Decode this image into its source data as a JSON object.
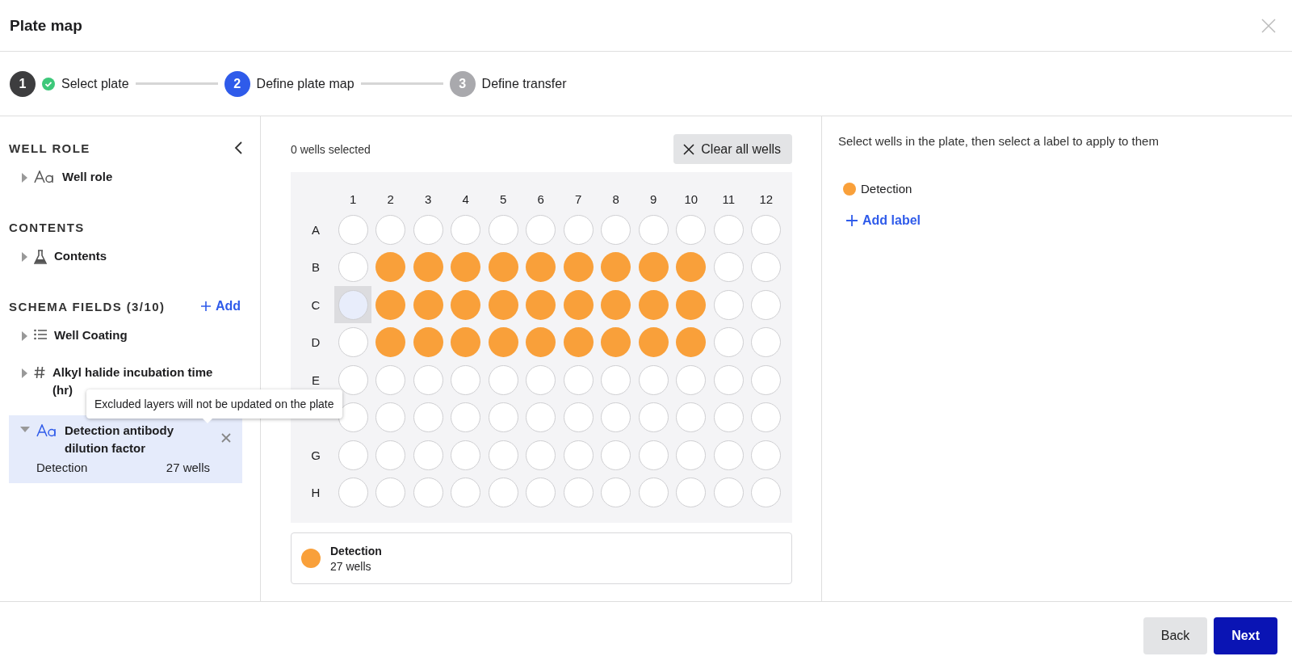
{
  "dialog": {
    "title": "Plate map"
  },
  "steps": [
    {
      "number": "1",
      "label": "Select plate",
      "kind": "done"
    },
    {
      "number": "2",
      "label": "Define plate map",
      "kind": "current"
    },
    {
      "number": "3",
      "label": "Define transfer",
      "kind": "upcoming"
    }
  ],
  "sidebar": {
    "sections": [
      {
        "heading": "WELL ROLE",
        "collapse": true,
        "items": [
          {
            "kind": "text",
            "label": "Well role",
            "expanded": false,
            "selected": false
          }
        ]
      },
      {
        "heading": "CONTENTS",
        "items": [
          {
            "kind": "flask",
            "label": "Contents",
            "expanded": false,
            "selected": false
          }
        ]
      },
      {
        "heading": "SCHEMA FIELDS (3/10)",
        "action": "Add",
        "items": [
          {
            "kind": "list",
            "label": "Well Coating",
            "expanded": false,
            "selected": false
          },
          {
            "kind": "number",
            "label": "Alkyl halide incubation time (hr)",
            "expanded": false,
            "selected": false
          },
          {
            "kind": "text",
            "label": "Detection antibody dilution factor",
            "expanded": true,
            "selected": true,
            "values": [
              {
                "label": "Detection",
                "count": "27 wells"
              }
            ]
          }
        ]
      }
    ]
  },
  "tooltip": "Excluded layers will not be updated on the plate",
  "plate": {
    "selection_count": "0 wells selected",
    "clear_button": "Clear all wells",
    "columns": [
      "1",
      "2",
      "3",
      "4",
      "5",
      "6",
      "7",
      "8",
      "9",
      "10",
      "11",
      "12"
    ],
    "rows": [
      {
        "label": "A",
        "wells": [
          {
            "kind": "empty"
          },
          {
            "kind": "empty"
          },
          {
            "kind": "empty"
          },
          {
            "kind": "empty"
          },
          {
            "kind": "empty"
          },
          {
            "kind": "empty"
          },
          {
            "kind": "empty"
          },
          {
            "kind": "empty"
          },
          {
            "kind": "empty"
          },
          {
            "kind": "empty"
          },
          {
            "kind": "empty"
          },
          {
            "kind": "empty"
          }
        ]
      },
      {
        "label": "B",
        "wells": [
          {
            "kind": "empty"
          },
          {
            "kind": "filled"
          },
          {
            "kind": "filled"
          },
          {
            "kind": "filled"
          },
          {
            "kind": "filled"
          },
          {
            "kind": "filled"
          },
          {
            "kind": "filled"
          },
          {
            "kind": "filled"
          },
          {
            "kind": "filled"
          },
          {
            "kind": "filled"
          },
          {
            "kind": "empty"
          },
          {
            "kind": "empty"
          }
        ]
      },
      {
        "label": "C",
        "wells": [
          {
            "kind": "hover"
          },
          {
            "kind": "filled"
          },
          {
            "kind": "filled"
          },
          {
            "kind": "filled"
          },
          {
            "kind": "filled"
          },
          {
            "kind": "filled"
          },
          {
            "kind": "filled"
          },
          {
            "kind": "filled"
          },
          {
            "kind": "filled"
          },
          {
            "kind": "filled"
          },
          {
            "kind": "empty"
          },
          {
            "kind": "empty"
          }
        ]
      },
      {
        "label": "D",
        "wells": [
          {
            "kind": "empty"
          },
          {
            "kind": "filled"
          },
          {
            "kind": "filled"
          },
          {
            "kind": "filled"
          },
          {
            "kind": "filled"
          },
          {
            "kind": "filled"
          },
          {
            "kind": "filled"
          },
          {
            "kind": "filled"
          },
          {
            "kind": "filled"
          },
          {
            "kind": "filled"
          },
          {
            "kind": "empty"
          },
          {
            "kind": "empty"
          }
        ]
      },
      {
        "label": "E",
        "wells": [
          {
            "kind": "empty"
          },
          {
            "kind": "empty"
          },
          {
            "kind": "empty"
          },
          {
            "kind": "empty"
          },
          {
            "kind": "empty"
          },
          {
            "kind": "empty"
          },
          {
            "kind": "empty"
          },
          {
            "kind": "empty"
          },
          {
            "kind": "empty"
          },
          {
            "kind": "empty"
          },
          {
            "kind": "empty"
          },
          {
            "kind": "empty"
          }
        ]
      },
      {
        "wells": [
          {
            "kind": "empty"
          },
          {
            "kind": "empty"
          },
          {
            "kind": "empty"
          },
          {
            "kind": "empty"
          },
          {
            "kind": "empty"
          },
          {
            "kind": "empty"
          },
          {
            "kind": "empty"
          },
          {
            "kind": "empty"
          },
          {
            "kind": "empty"
          },
          {
            "kind": "empty"
          },
          {
            "kind": "empty"
          },
          {
            "kind": "empty"
          }
        ]
      },
      {
        "label": "G",
        "wells": [
          {
            "kind": "empty"
          },
          {
            "kind": "empty"
          },
          {
            "kind": "empty"
          },
          {
            "kind": "empty"
          },
          {
            "kind": "empty"
          },
          {
            "kind": "empty"
          },
          {
            "kind": "empty"
          },
          {
            "kind": "empty"
          },
          {
            "kind": "empty"
          },
          {
            "kind": "empty"
          },
          {
            "kind": "empty"
          },
          {
            "kind": "empty"
          }
        ]
      },
      {
        "label": "H",
        "wells": [
          {
            "kind": "empty"
          },
          {
            "kind": "empty"
          },
          {
            "kind": "empty"
          },
          {
            "kind": "empty"
          },
          {
            "kind": "empty"
          },
          {
            "kind": "empty"
          },
          {
            "kind": "empty"
          },
          {
            "kind": "empty"
          },
          {
            "kind": "empty"
          },
          {
            "kind": "empty"
          },
          {
            "kind": "empty"
          },
          {
            "kind": "empty"
          }
        ]
      }
    ]
  },
  "legend": [
    {
      "label": "Detection",
      "count": "27 wells",
      "color": "#f9a03a"
    }
  ],
  "labels_panel": {
    "instruction": "Select wells in the plate, then select a label to apply to them",
    "labels": [
      {
        "label": "Detection",
        "color": "#f9a03a"
      }
    ],
    "add_button": "Add label"
  },
  "buttons": [
    {
      "label": "Back",
      "kind": "secondary"
    },
    {
      "label": "Next",
      "kind": "primary"
    }
  ]
}
